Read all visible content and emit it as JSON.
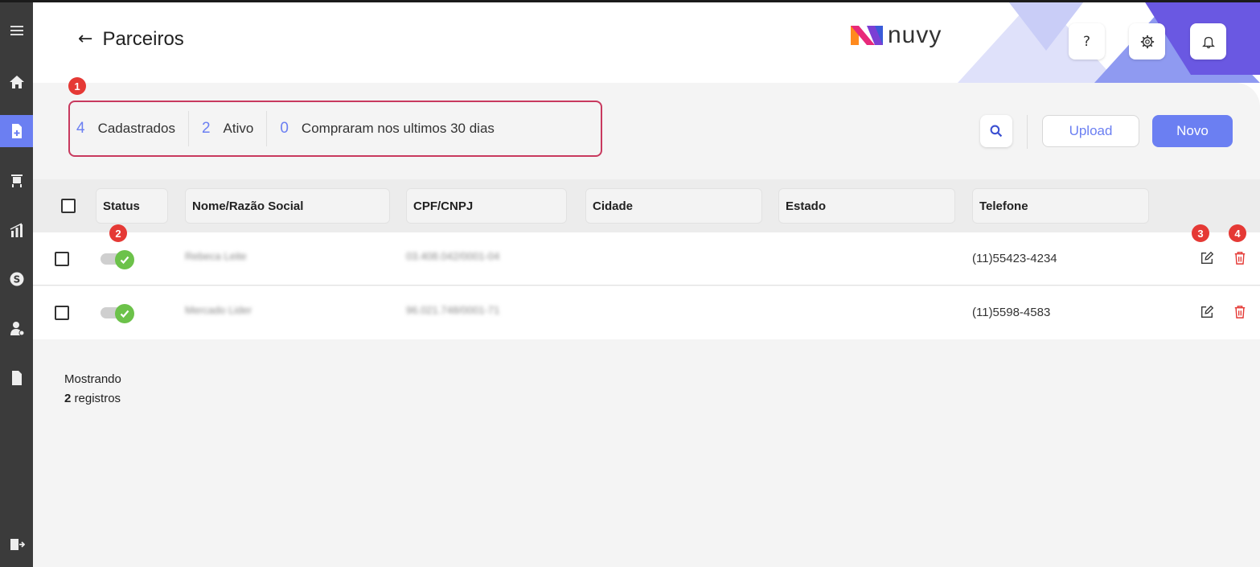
{
  "header": {
    "back_arrow": "←",
    "title": "Parceiros",
    "logo_text": "nuvy",
    "help_label": "?",
    "colors": {
      "accent": "#6b7ff2",
      "triangle_light": "#c9cdf7",
      "triangle_mid": "#8f9af1",
      "triangle_dark": "#5a3ad6"
    }
  },
  "sidebar": {
    "items": [
      {
        "icon": "menu-icon"
      },
      {
        "icon": "home-icon"
      },
      {
        "icon": "add-document-icon",
        "active": true
      },
      {
        "icon": "cart-icon"
      },
      {
        "icon": "sales-chart-icon"
      },
      {
        "icon": "dollar-coin-icon"
      },
      {
        "icon": "user-money-icon"
      },
      {
        "icon": "document-icon"
      },
      {
        "icon": "logout-icon"
      }
    ]
  },
  "summary": {
    "items": [
      {
        "value": "4",
        "label": "Cadastrados"
      },
      {
        "value": "2",
        "label": "Ativo"
      },
      {
        "value": "0",
        "label": "Compraram nos ultimos 30 dias"
      }
    ]
  },
  "badges": {
    "b1": "1",
    "b2": "2",
    "b3": "3",
    "b4": "4"
  },
  "toolbar": {
    "upload_label": "Upload",
    "novo_label": "Novo"
  },
  "table": {
    "columns": [
      "Status",
      "Nome/Razão Social",
      "CPF/CNPJ",
      "Cidade",
      "Estado",
      "Telefone"
    ],
    "rows": [
      {
        "status": "active",
        "name": "Rebeca Leite",
        "cpf": "03.408.042/0001-04",
        "cidade": "",
        "estado": "",
        "telefone": "(11)55423-4234"
      },
      {
        "status": "active",
        "name": "Mercado Lider",
        "cpf": "96.021.748/0001-71",
        "cidade": "",
        "estado": "",
        "telefone": "(11)5598-4583"
      }
    ]
  },
  "footer": {
    "showing_label": "Mostrando",
    "count": "2",
    "count_label": "registros"
  }
}
